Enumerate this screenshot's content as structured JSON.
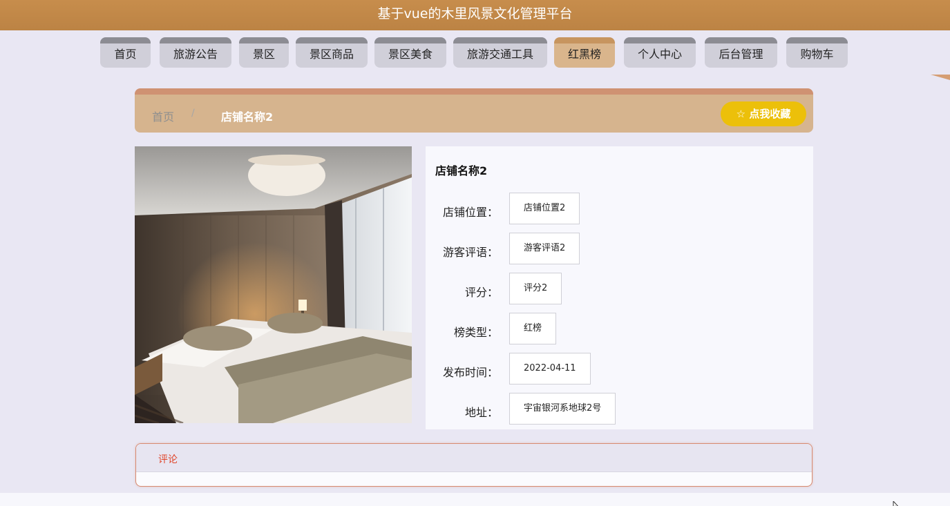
{
  "site": {
    "title": "基于vue的木里风景文化管理平台"
  },
  "nav": {
    "items": [
      {
        "label": "首页",
        "active": false
      },
      {
        "label": "旅游公告",
        "active": false
      },
      {
        "label": "景区",
        "active": false
      },
      {
        "label": "景区商品",
        "active": false
      },
      {
        "label": "景区美食",
        "active": false
      },
      {
        "label": "旅游交通工具",
        "active": false
      },
      {
        "label": "红黑榜",
        "active": true
      },
      {
        "label": "个人中心",
        "active": false
      },
      {
        "label": "后台管理",
        "active": false
      },
      {
        "label": "购物车",
        "active": false
      }
    ]
  },
  "breadcrumb": {
    "home": "首页",
    "separator": "/",
    "current": "店铺名称2"
  },
  "favorite": {
    "icon": "star-outline-icon",
    "label": "☆ 点我收藏"
  },
  "detail": {
    "title": "店铺名称2",
    "image": "hotel-bedroom-photo",
    "fields": [
      {
        "label": "店铺位置：",
        "value": "店铺位置2"
      },
      {
        "label": "游客评语：",
        "value": "游客评语2"
      },
      {
        "label": "评分：",
        "value": "评分2"
      },
      {
        "label": "榜类型：",
        "value": "红榜"
      },
      {
        "label": "发布时间：",
        "value": "2022-04-11"
      },
      {
        "label": "地址：",
        "value": "宇宙银河系地球2号"
      }
    ]
  },
  "comments": {
    "tab_label": "评论"
  },
  "colors": {
    "header": "#c78d4c",
    "nav_active": "#d9b58c",
    "breadcrumb_bg": "#d6b48e",
    "favorite_btn": "#ecc00a",
    "comment_accent": "#e0452a"
  }
}
